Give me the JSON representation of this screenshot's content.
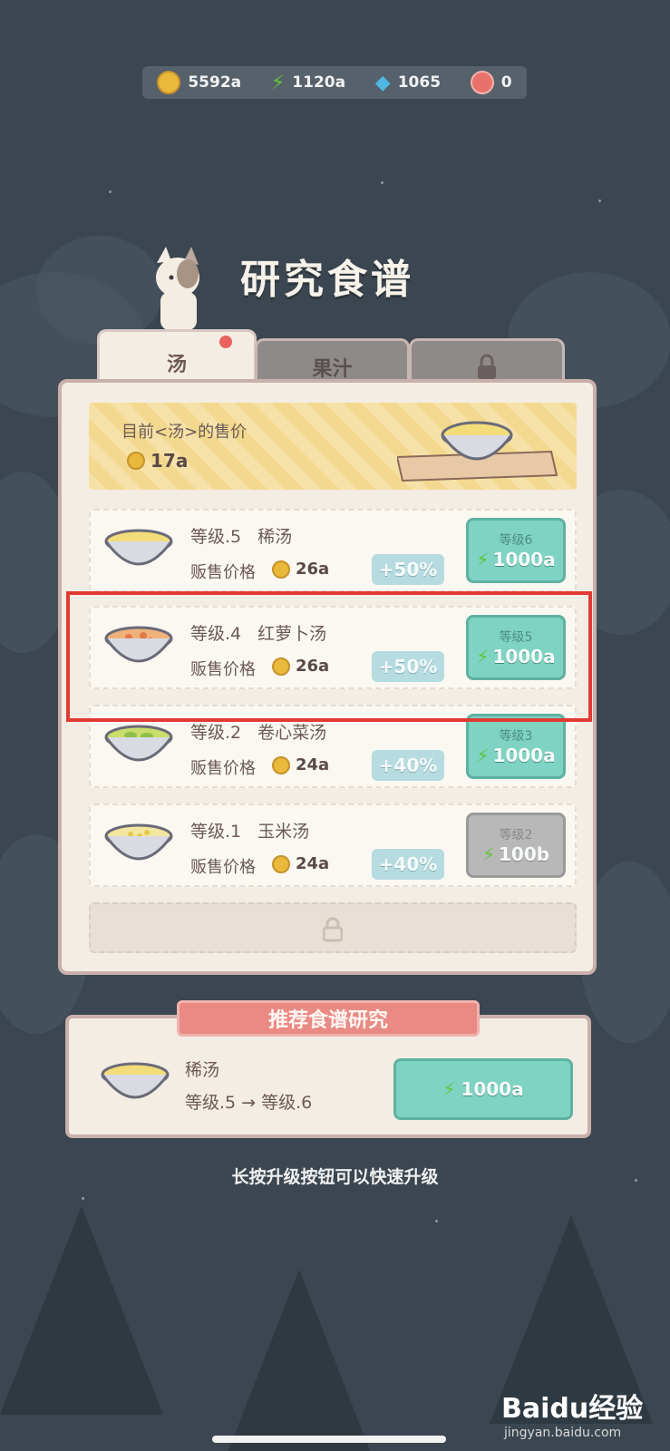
{
  "currencies": [
    {
      "icon": "coin-icon",
      "value": "5592a",
      "color": "#e8b93a"
    },
    {
      "icon": "energy-icon",
      "value": "1120a",
      "color": "#5ec43c"
    },
    {
      "icon": "gem-icon",
      "value": "1065",
      "color": "#4fb6e0"
    },
    {
      "icon": "ticket-icon",
      "value": "0",
      "color": "#e8726b"
    }
  ],
  "title": "研究食谱",
  "tabs": [
    {
      "label": "汤",
      "active": true,
      "badge": true
    },
    {
      "label": "果汁",
      "active": false
    },
    {
      "label": "",
      "locked": true
    }
  ],
  "price_banner": {
    "label": "目前<汤>的售价",
    "value": "17a"
  },
  "recipes": [
    {
      "level": "等级.5",
      "name": "稀汤",
      "sell_label": "贩售价格",
      "price": "26a",
      "bonus": "+50%",
      "next_level": "等级6",
      "cost": "1000a",
      "button_state": "available",
      "soup_color": "#f3dc7a"
    },
    {
      "level": "等级.4",
      "name": "红萝卜汤",
      "sell_label": "贩售价格",
      "price": "26a",
      "bonus": "+50%",
      "next_level": "等级5",
      "cost": "1000a",
      "button_state": "available",
      "soup_color": "#efb27a",
      "highlighted": true
    },
    {
      "level": "等级.2",
      "name": "卷心菜汤",
      "sell_label": "贩售价格",
      "price": "24a",
      "bonus": "+40%",
      "next_level": "等级3",
      "cost": "1000a",
      "button_state": "available",
      "soup_color": "#c9dd6a"
    },
    {
      "level": "等级.1",
      "name": "玉米汤",
      "sell_label": "贩售价格",
      "price": "24a",
      "bonus": "+40%",
      "next_level": "等级2",
      "cost": "100b",
      "button_state": "disabled",
      "soup_color": "#f3e6a0"
    }
  ],
  "recommend": {
    "title": "推荐食谱研究",
    "name": "稀汤",
    "levels": "等级.5  →  等级.6",
    "cost": "1000a"
  },
  "hint": "长按升级按钮可以快速升级",
  "watermark": {
    "brand": "Baidu经验",
    "url": "jingyan.baidu.com"
  }
}
